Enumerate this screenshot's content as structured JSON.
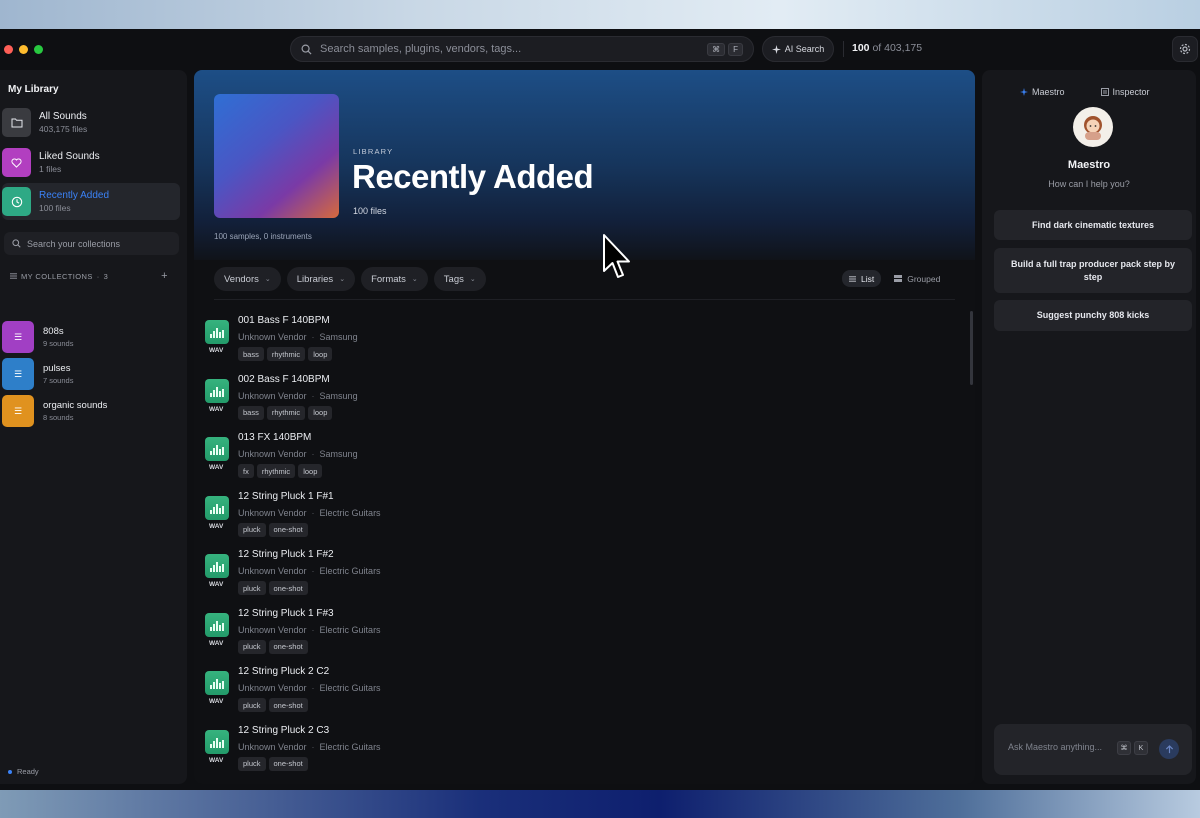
{
  "topbar": {
    "search_placeholder": "Search samples, plugins, vendors, tags...",
    "search_shortcut": [
      "⌘",
      "F"
    ],
    "ai_search_label": "AI Search",
    "count_shown": "100",
    "count_of": "of 403,175"
  },
  "sidebar": {
    "title": "My Library",
    "library": [
      {
        "name": "All Sounds",
        "sub": "403,175 files",
        "icon": "folder-icon",
        "color": "#3a3b40"
      },
      {
        "name": "Liked Sounds",
        "sub": "1 files",
        "icon": "heart-icon",
        "color": "#b23fc0"
      },
      {
        "name": "Recently Added",
        "sub": "100 files",
        "icon": "clock-icon",
        "color": "#2ea985"
      }
    ],
    "collections_search_placeholder": "Search your collections",
    "collections_header": "MY COLLECTIONS",
    "collections_count": "3",
    "collections": [
      {
        "name": "808s",
        "sub": "9 sounds",
        "color": "#a13fc4"
      },
      {
        "name": "pulses",
        "sub": "7 sounds",
        "color": "#2e7fc9"
      },
      {
        "name": "organic sounds",
        "sub": "8 sounds",
        "color": "#e0921f"
      }
    ],
    "status": "Ready"
  },
  "hero": {
    "kicker": "LIBRARY",
    "title": "Recently Added",
    "count": "100 files",
    "meta": "100 samples, 0 instruments"
  },
  "filters": [
    "Vendors",
    "Libraries",
    "Formats",
    "Tags"
  ],
  "view_toggle": {
    "list": "List",
    "grouped": "Grouped",
    "active": "list"
  },
  "rows": [
    {
      "name": "001 Bass F 140BPM",
      "vendor": "Unknown Vendor",
      "library": "Samsung",
      "format": "WAV",
      "tags": [
        "bass",
        "rhythmic",
        "loop"
      ]
    },
    {
      "name": "002 Bass F 140BPM",
      "vendor": "Unknown Vendor",
      "library": "Samsung",
      "format": "WAV",
      "tags": [
        "bass",
        "rhythmic",
        "loop"
      ]
    },
    {
      "name": "013 FX 140BPM",
      "vendor": "Unknown Vendor",
      "library": "Samsung",
      "format": "WAV",
      "tags": [
        "fx",
        "rhythmic",
        "loop"
      ]
    },
    {
      "name": "12 String Pluck 1 F#1",
      "vendor": "Unknown Vendor",
      "library": "Electric Guitars",
      "format": "WAV",
      "tags": [
        "pluck",
        "one-shot"
      ]
    },
    {
      "name": "12 String Pluck 1 F#2",
      "vendor": "Unknown Vendor",
      "library": "Electric Guitars",
      "format": "WAV",
      "tags": [
        "pluck",
        "one-shot"
      ]
    },
    {
      "name": "12 String Pluck 1 F#3",
      "vendor": "Unknown Vendor",
      "library": "Electric Guitars",
      "format": "WAV",
      "tags": [
        "pluck",
        "one-shot"
      ]
    },
    {
      "name": "12 String Pluck 2 C2",
      "vendor": "Unknown Vendor",
      "library": "Electric Guitars",
      "format": "WAV",
      "tags": [
        "pluck",
        "one-shot"
      ]
    },
    {
      "name": "12 String Pluck 2 C3",
      "vendor": "Unknown Vendor",
      "library": "Electric Guitars",
      "format": "WAV",
      "tags": [
        "pluck",
        "one-shot"
      ]
    }
  ],
  "right_panel": {
    "tabs": [
      "Maestro",
      "Inspector"
    ],
    "assistant_name": "Maestro",
    "assistant_prompt": "How can I help you?",
    "suggestions": [
      "Find dark cinematic textures",
      "Build a full trap producer pack step by step",
      "Suggest punchy 808 kicks"
    ],
    "ask_placeholder": "Ask Maestro anything...",
    "ask_shortcut": [
      "⌘",
      "K"
    ]
  },
  "colors": {
    "accent": "#3b82f6",
    "wav_badge": "#2ea97a"
  }
}
